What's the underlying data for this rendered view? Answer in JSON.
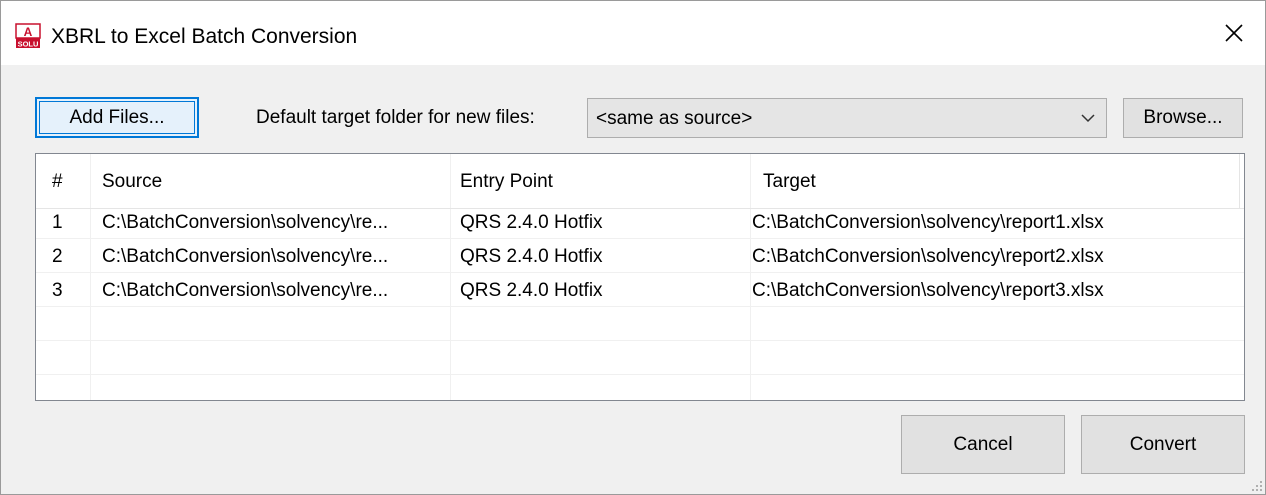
{
  "window": {
    "title": "XBRL to Excel Batch Conversion"
  },
  "icons": {
    "app": "solvency-app-icon",
    "close": "close-icon",
    "dropdown": "chevron-down-icon",
    "grip": "resize-grip-icon"
  },
  "colors": {
    "accent": "#0078d7",
    "button_face": "#e1e1e1",
    "dialog_bg": "#f0f0f0",
    "icon_red": "#c8102e"
  },
  "toolbar": {
    "add_files_label": "Add Files...",
    "target_folder_label": "Default target folder for new files:",
    "target_folder_value": "<same as source>",
    "browse_label": "Browse..."
  },
  "table": {
    "headers": {
      "num": "#",
      "source": "Source",
      "entry_point": "Entry Point",
      "target": "Target"
    },
    "rows": [
      {
        "num": "1",
        "source": "C:\\BatchConversion\\solvency\\re...",
        "entry_point": "QRS 2.4.0 Hotfix",
        "target": "C:\\BatchConversion\\solvency\\report1.xlsx"
      },
      {
        "num": "2",
        "source": "C:\\BatchConversion\\solvency\\re...",
        "entry_point": "QRS 2.4.0 Hotfix",
        "target": "C:\\BatchConversion\\solvency\\report2.xlsx"
      },
      {
        "num": "3",
        "source": "C:\\BatchConversion\\solvency\\re...",
        "entry_point": "QRS 2.4.0 Hotfix",
        "target": "C:\\BatchConversion\\solvency\\report3.xlsx"
      }
    ]
  },
  "footer": {
    "cancel_label": "Cancel",
    "convert_label": "Convert"
  }
}
